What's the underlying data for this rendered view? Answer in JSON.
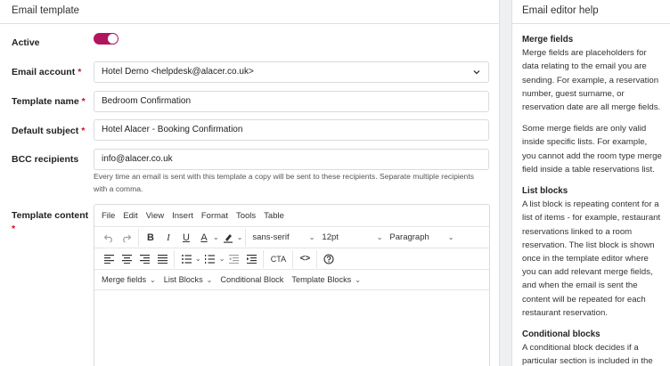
{
  "left_title": "Email template",
  "active": {
    "label": "Active",
    "on": true,
    "color": "#b0155f"
  },
  "email_account": {
    "label": "Email account",
    "value": "Hotel Demo <helpdesk@alacer.co.uk>"
  },
  "template_name": {
    "label": "Template name",
    "value": "Bedroom Confirmation"
  },
  "default_subject": {
    "label": "Default subject",
    "value": "Hotel Alacer - Booking Confirmation"
  },
  "bcc": {
    "label": "BCC recipients",
    "value": "info@alacer.co.uk",
    "help": "Every time an email is sent with this template a copy will be sent to these recipients. Separate multiple recipients with a comma."
  },
  "template_content": {
    "label": "Template content",
    "menu": [
      "File",
      "Edit",
      "View",
      "Insert",
      "Format",
      "Tools",
      "Table"
    ],
    "font_family": "sans-serif",
    "font_size": "12pt",
    "block_format": "Paragraph",
    "cta_label": "CTA",
    "blocks": [
      "Merge fields",
      "List Blocks",
      "Conditional Block",
      "Template Blocks"
    ]
  },
  "help_panel": {
    "title": "Email editor help",
    "sections": [
      {
        "heading": "Merge fields",
        "body": "Merge fields are placeholders for data relating to the email you are sending. For example, a reservation number, guest surname, or reservation date are all merge fields."
      },
      {
        "heading": "",
        "body": "Some merge fields are only valid inside specific lists. For example, you cannot add the room type merge field inside a table reservations list."
      },
      {
        "heading": "List blocks",
        "body": "A list block is repeating content for a list of items - for example, restaurant reservations linked to a room reservation. The list block is shown once in the template editor where you can add relevant merge fields, and when the email is sent the content will be repeated for each restaurant reservation."
      },
      {
        "heading": "Conditional blocks",
        "body": "A conditional block decides if a particular section is included in the email based on a specified condition."
      }
    ]
  }
}
